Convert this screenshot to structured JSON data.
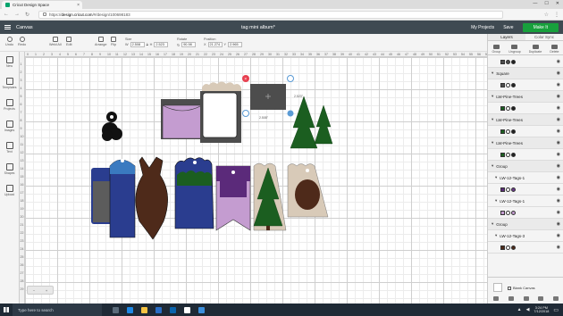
{
  "browser": {
    "tab_title": "Cricut Design Space",
    "tab_close": "×",
    "url_prefix": "https://",
    "url_domain": "design.cricut.com",
    "url_path": "/#/design/100698183",
    "window_controls": [
      "—",
      "☐",
      "✕"
    ]
  },
  "header": {
    "canvas_label": "Canvas",
    "project_title": "tag mini album*",
    "my_projects": "My Projects",
    "save": "Save",
    "make_it": "Make It"
  },
  "toolbar": {
    "undo": "Undo",
    "redo": "Redo",
    "weld_all": "Weld All",
    "edit": "Edit",
    "arrange": "Arrange",
    "flip": "Flip",
    "size_label": "Size",
    "w_prefix": "W",
    "w_value": "2.508",
    "h_prefix": "H",
    "h_value": "2.523",
    "rotate_label": "Rotate",
    "rotate_value": "90.98",
    "position_label": "Position",
    "x_prefix": "X",
    "x_value": "21.274",
    "y_prefix": "Y",
    "y_value": "2.965"
  },
  "sidebar": {
    "items": [
      {
        "label": "New",
        "icon": "plus-icon"
      },
      {
        "label": "Templates",
        "icon": "shirt-icon"
      },
      {
        "label": "Projects",
        "icon": "projects-icon"
      },
      {
        "label": "Images",
        "icon": "image-icon"
      },
      {
        "label": "Text",
        "icon": "text-icon"
      },
      {
        "label": "Shapes",
        "icon": "shapes-icon"
      },
      {
        "label": "Upload",
        "icon": "upload-icon"
      }
    ]
  },
  "canvas": {
    "ruler_top": [
      "0",
      "1",
      "2",
      "3",
      "4",
      "5",
      "6",
      "7",
      "8",
      "9",
      "10",
      "11",
      "12",
      "13",
      "14",
      "15",
      "16",
      "17",
      "18",
      "19",
      "20",
      "21",
      "22",
      "23",
      "24",
      "25",
      "26",
      "27",
      "28",
      "29",
      "30",
      "31",
      "32",
      "33",
      "34",
      "35",
      "36",
      "37",
      "38",
      "39",
      "40",
      "41",
      "42",
      "43",
      "44",
      "45",
      "46",
      "47",
      "48",
      "49",
      "50",
      "51",
      "52",
      "53",
      "54",
      "55",
      "56",
      "57"
    ],
    "ruler_left": [
      "1",
      "2",
      "3",
      "4",
      "5",
      "6",
      "7",
      "8",
      "9",
      "10",
      "11",
      "12",
      "13",
      "14",
      "15",
      "16",
      "17",
      "18",
      "19",
      "20",
      "21",
      "22",
      "23",
      "24",
      "25",
      "26",
      "27",
      "28",
      "29"
    ],
    "dim_width": "2.508\"",
    "dim_height": "2.523\""
  },
  "zoom": {
    "minus": "−",
    "value": "",
    "plus": "+"
  },
  "panel": {
    "tabs": [
      "Layers",
      "Color Sync"
    ],
    "tools": [
      "Group",
      "Ungroup",
      "Duplicate",
      "Delete"
    ],
    "layers": [
      {
        "type": "thumbs",
        "name": "",
        "thumbs": [
          "#4d4d4d",
          "#4d4d4d",
          "#222"
        ]
      },
      {
        "type": "group",
        "name": "Square"
      },
      {
        "type": "thumbs",
        "name": "",
        "thumbs": [
          "#4d4d4d",
          "#fff",
          "#222"
        ]
      },
      {
        "type": "group",
        "name": "LW-Pine-Trees"
      },
      {
        "type": "thumbs",
        "name": "",
        "thumbs": [
          "#1b5e20",
          "#fff",
          "#222"
        ]
      },
      {
        "type": "group",
        "name": "LW-Pine-Trees"
      },
      {
        "type": "thumbs",
        "name": "",
        "thumbs": [
          "#1b5e20",
          "#fff",
          "#222"
        ]
      },
      {
        "type": "group",
        "name": "LW-Pine-Trees"
      },
      {
        "type": "thumbs",
        "name": "",
        "thumbs": [
          "#1b5e20",
          "#fff",
          "#222"
        ]
      },
      {
        "type": "group",
        "name": "Group"
      },
      {
        "type": "sub",
        "name": "LW-12-Tags-1"
      },
      {
        "type": "thumbs",
        "name": "",
        "thumbs": [
          "#5b2a7a",
          "#fff",
          "#6b3a8a"
        ]
      },
      {
        "type": "sub",
        "name": "LW-12-Tags-1"
      },
      {
        "type": "thumbs",
        "name": "",
        "thumbs": [
          "#c49cd0",
          "#fff",
          "#c49cd0"
        ]
      },
      {
        "type": "group",
        "name": "Group"
      },
      {
        "type": "sub",
        "name": "LW-12-Tags-3"
      },
      {
        "type": "thumbs",
        "name": "",
        "thumbs": [
          "#4e2a1a",
          "#fff",
          "#4e2a1a"
        ]
      }
    ],
    "blank_canvas": "Blank Canvas"
  },
  "taskbar": {
    "search_placeholder": "Type here to search",
    "time": "3:24 PM",
    "date": "7/12/2018"
  },
  "colors": {
    "header_bg": "#3f4a52",
    "make_it": "#17a03c",
    "tag_gray": "#5c5c5c",
    "tag_blue": "#2a3d8f",
    "tag_brown": "#4e2a1a",
    "tag_purple": "#5b2a7a",
    "tag_lilac": "#c49cd0",
    "tag_beige": "#d8cab8",
    "pine_green": "#1b5e20"
  }
}
